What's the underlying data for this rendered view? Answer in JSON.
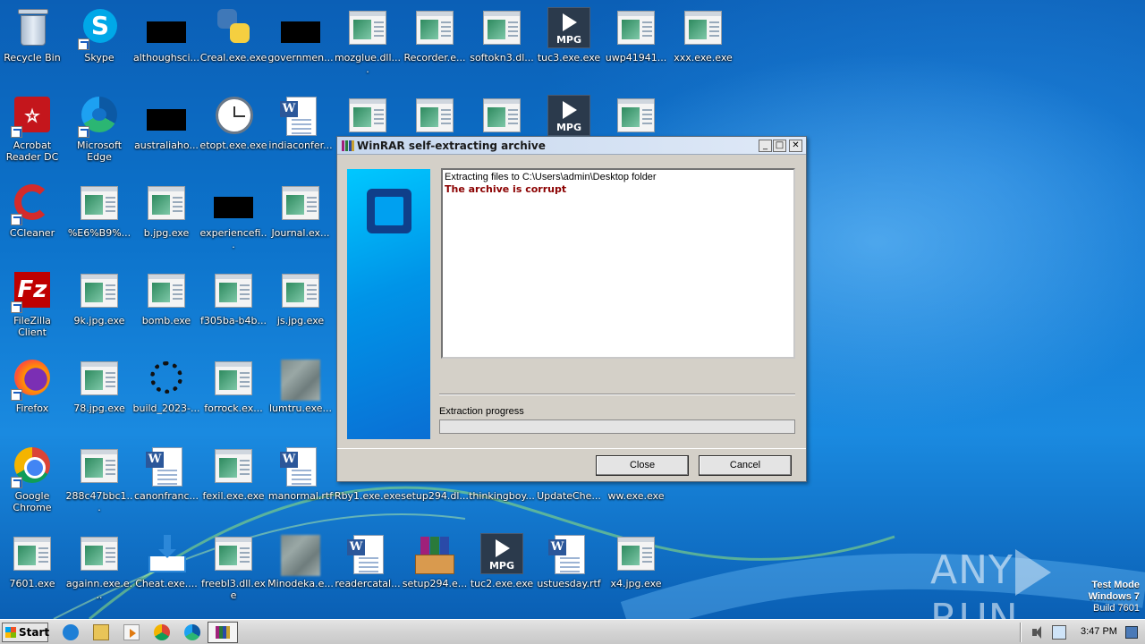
{
  "desktop": {
    "icons": [
      {
        "label": "Recycle Bin",
        "kind": "recycle"
      },
      {
        "label": "Skype",
        "kind": "skype"
      },
      {
        "label": "althoughsci...",
        "kind": "black"
      },
      {
        "label": "Creal.exe.exe",
        "kind": "python"
      },
      {
        "label": "governmen...",
        "kind": "black"
      },
      {
        "label": "mozglue.dll....",
        "kind": "exe"
      },
      {
        "label": "Recorder.e...",
        "kind": "exe"
      },
      {
        "label": "softokn3.dl...",
        "kind": "exe"
      },
      {
        "label": "tuc3.exe.exe",
        "kind": "mpg"
      },
      {
        "label": "uwp41941...",
        "kind": "exe"
      },
      {
        "label": "xxx.exe.exe",
        "kind": "exe"
      },
      {
        "label": "Acrobat Reader DC",
        "kind": "acrobat"
      },
      {
        "label": "Microsoft Edge",
        "kind": "edge"
      },
      {
        "label": "australiaho...",
        "kind": "black"
      },
      {
        "label": "etopt.exe.exe",
        "kind": "clock"
      },
      {
        "label": "indiaconfer...",
        "kind": "doc"
      },
      {
        "label": "",
        "kind": "exe"
      },
      {
        "label": "",
        "kind": "exe"
      },
      {
        "label": "",
        "kind": "exe"
      },
      {
        "label": "",
        "kind": "mpg"
      },
      {
        "label": "",
        "kind": "exe"
      },
      {
        "label": "CCleaner",
        "kind": "ccleaner"
      },
      {
        "label": "%E6%B9%...",
        "kind": "exe"
      },
      {
        "label": "b.jpg.exe",
        "kind": "exe"
      },
      {
        "label": "experiencefi...",
        "kind": "black"
      },
      {
        "label": "Journal.ex...",
        "kind": "exe"
      },
      {
        "label": "FileZilla Client",
        "kind": "filezilla"
      },
      {
        "label": "9k.jpg.exe",
        "kind": "exe"
      },
      {
        "label": "bomb.exe",
        "kind": "exe"
      },
      {
        "label": "f305ba-b4b...",
        "kind": "exe"
      },
      {
        "label": "js.jpg.exe",
        "kind": "exe"
      },
      {
        "label": "Firefox",
        "kind": "firefox"
      },
      {
        "label": "78.jpg.exe",
        "kind": "exe"
      },
      {
        "label": "build_2023-...",
        "kind": "spinner"
      },
      {
        "label": "forrock.ex...",
        "kind": "exe"
      },
      {
        "label": "lumtru.exe...",
        "kind": "blur"
      },
      {
        "label": "Google Chrome",
        "kind": "chrome"
      },
      {
        "label": "288c47bbc1...",
        "kind": "exe"
      },
      {
        "label": "canonfranc...",
        "kind": "doc"
      },
      {
        "label": "fexil.exe.exe",
        "kind": "exe"
      },
      {
        "label": "manormal.rtf",
        "kind": "doc"
      },
      {
        "label": "Rby1.exe.exe",
        "kind": "none"
      },
      {
        "label": "setup294.dl...",
        "kind": "none"
      },
      {
        "label": "thinkingboy...",
        "kind": "none"
      },
      {
        "label": "UpdateChe...",
        "kind": "none"
      },
      {
        "label": "ww.exe.exe",
        "kind": "none"
      },
      {
        "label": "7601.exe",
        "kind": "exe"
      },
      {
        "label": "againn.exe.e...",
        "kind": "exe"
      },
      {
        "label": "Cheat.exe....",
        "kind": "download"
      },
      {
        "label": "freebl3.dll.exe",
        "kind": "exe"
      },
      {
        "label": "Minodeka.e...",
        "kind": "blur"
      },
      {
        "label": "readercatal...",
        "kind": "doc"
      },
      {
        "label": "setup294.e...",
        "kind": "rar"
      },
      {
        "label": "tuc2.exe.exe",
        "kind": "mpg"
      },
      {
        "label": "ustuesday.rtf",
        "kind": "doc"
      },
      {
        "label": "x4.jpg.exe",
        "kind": "exe"
      }
    ]
  },
  "dialog": {
    "title": "WinRAR self-extracting archive",
    "log_line1": "Extracting files to C:\\Users\\admin\\Desktop folder",
    "log_line2": "The archive is corrupt",
    "progress_label": "Extraction progress",
    "progress_fraction": 0,
    "close_label": "Close",
    "cancel_label": "Cancel",
    "btn_minimize": "_",
    "btn_maximize": "□",
    "btn_close": "✕"
  },
  "watermark": {
    "text_left": "ANY",
    "text_right": "RUN",
    "line1": "Test Mode",
    "line2": "Windows 7",
    "line3": "Build 7601"
  },
  "taskbar": {
    "start_label": "Start",
    "clock": "3:47 PM"
  },
  "colors": {
    "error_text": "#8b0000",
    "desktop_blue": "#0d74cc",
    "dialog_face": "#d4d0c8"
  }
}
